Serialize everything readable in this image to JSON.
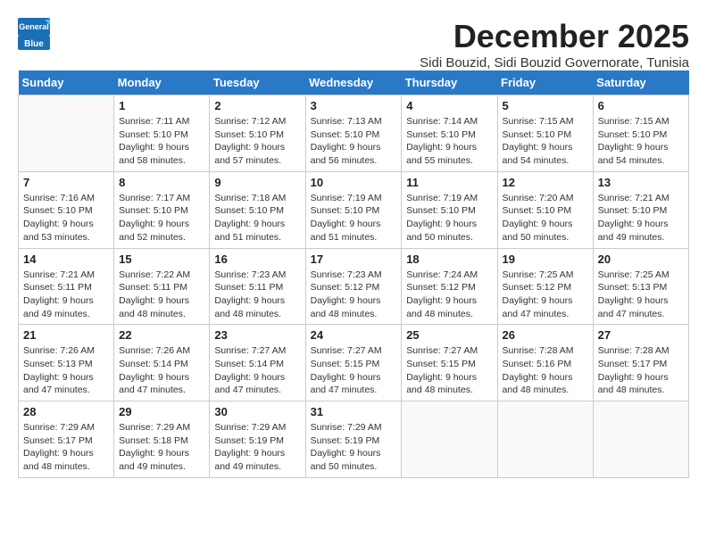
{
  "logo": {
    "line1": "General",
    "line2": "Blue"
  },
  "title": "December 2025",
  "location": "Sidi Bouzid, Sidi Bouzid Governorate, Tunisia",
  "days_of_week": [
    "Sunday",
    "Monday",
    "Tuesday",
    "Wednesday",
    "Thursday",
    "Friday",
    "Saturday"
  ],
  "weeks": [
    [
      {
        "day": "",
        "info": ""
      },
      {
        "day": "1",
        "info": "Sunrise: 7:11 AM\nSunset: 5:10 PM\nDaylight: 9 hours\nand 58 minutes."
      },
      {
        "day": "2",
        "info": "Sunrise: 7:12 AM\nSunset: 5:10 PM\nDaylight: 9 hours\nand 57 minutes."
      },
      {
        "day": "3",
        "info": "Sunrise: 7:13 AM\nSunset: 5:10 PM\nDaylight: 9 hours\nand 56 minutes."
      },
      {
        "day": "4",
        "info": "Sunrise: 7:14 AM\nSunset: 5:10 PM\nDaylight: 9 hours\nand 55 minutes."
      },
      {
        "day": "5",
        "info": "Sunrise: 7:15 AM\nSunset: 5:10 PM\nDaylight: 9 hours\nand 54 minutes."
      },
      {
        "day": "6",
        "info": "Sunrise: 7:15 AM\nSunset: 5:10 PM\nDaylight: 9 hours\nand 54 minutes."
      }
    ],
    [
      {
        "day": "7",
        "info": "Sunrise: 7:16 AM\nSunset: 5:10 PM\nDaylight: 9 hours\nand 53 minutes."
      },
      {
        "day": "8",
        "info": "Sunrise: 7:17 AM\nSunset: 5:10 PM\nDaylight: 9 hours\nand 52 minutes."
      },
      {
        "day": "9",
        "info": "Sunrise: 7:18 AM\nSunset: 5:10 PM\nDaylight: 9 hours\nand 51 minutes."
      },
      {
        "day": "10",
        "info": "Sunrise: 7:19 AM\nSunset: 5:10 PM\nDaylight: 9 hours\nand 51 minutes."
      },
      {
        "day": "11",
        "info": "Sunrise: 7:19 AM\nSunset: 5:10 PM\nDaylight: 9 hours\nand 50 minutes."
      },
      {
        "day": "12",
        "info": "Sunrise: 7:20 AM\nSunset: 5:10 PM\nDaylight: 9 hours\nand 50 minutes."
      },
      {
        "day": "13",
        "info": "Sunrise: 7:21 AM\nSunset: 5:10 PM\nDaylight: 9 hours\nand 49 minutes."
      }
    ],
    [
      {
        "day": "14",
        "info": "Sunrise: 7:21 AM\nSunset: 5:11 PM\nDaylight: 9 hours\nand 49 minutes."
      },
      {
        "day": "15",
        "info": "Sunrise: 7:22 AM\nSunset: 5:11 PM\nDaylight: 9 hours\nand 48 minutes."
      },
      {
        "day": "16",
        "info": "Sunrise: 7:23 AM\nSunset: 5:11 PM\nDaylight: 9 hours\nand 48 minutes."
      },
      {
        "day": "17",
        "info": "Sunrise: 7:23 AM\nSunset: 5:12 PM\nDaylight: 9 hours\nand 48 minutes."
      },
      {
        "day": "18",
        "info": "Sunrise: 7:24 AM\nSunset: 5:12 PM\nDaylight: 9 hours\nand 48 minutes."
      },
      {
        "day": "19",
        "info": "Sunrise: 7:25 AM\nSunset: 5:12 PM\nDaylight: 9 hours\nand 47 minutes."
      },
      {
        "day": "20",
        "info": "Sunrise: 7:25 AM\nSunset: 5:13 PM\nDaylight: 9 hours\nand 47 minutes."
      }
    ],
    [
      {
        "day": "21",
        "info": "Sunrise: 7:26 AM\nSunset: 5:13 PM\nDaylight: 9 hours\nand 47 minutes."
      },
      {
        "day": "22",
        "info": "Sunrise: 7:26 AM\nSunset: 5:14 PM\nDaylight: 9 hours\nand 47 minutes."
      },
      {
        "day": "23",
        "info": "Sunrise: 7:27 AM\nSunset: 5:14 PM\nDaylight: 9 hours\nand 47 minutes."
      },
      {
        "day": "24",
        "info": "Sunrise: 7:27 AM\nSunset: 5:15 PM\nDaylight: 9 hours\nand 47 minutes."
      },
      {
        "day": "25",
        "info": "Sunrise: 7:27 AM\nSunset: 5:15 PM\nDaylight: 9 hours\nand 48 minutes."
      },
      {
        "day": "26",
        "info": "Sunrise: 7:28 AM\nSunset: 5:16 PM\nDaylight: 9 hours\nand 48 minutes."
      },
      {
        "day": "27",
        "info": "Sunrise: 7:28 AM\nSunset: 5:17 PM\nDaylight: 9 hours\nand 48 minutes."
      }
    ],
    [
      {
        "day": "28",
        "info": "Sunrise: 7:29 AM\nSunset: 5:17 PM\nDaylight: 9 hours\nand 48 minutes."
      },
      {
        "day": "29",
        "info": "Sunrise: 7:29 AM\nSunset: 5:18 PM\nDaylight: 9 hours\nand 49 minutes."
      },
      {
        "day": "30",
        "info": "Sunrise: 7:29 AM\nSunset: 5:19 PM\nDaylight: 9 hours\nand 49 minutes."
      },
      {
        "day": "31",
        "info": "Sunrise: 7:29 AM\nSunset: 5:19 PM\nDaylight: 9 hours\nand 50 minutes."
      },
      {
        "day": "",
        "info": ""
      },
      {
        "day": "",
        "info": ""
      },
      {
        "day": "",
        "info": ""
      }
    ]
  ]
}
